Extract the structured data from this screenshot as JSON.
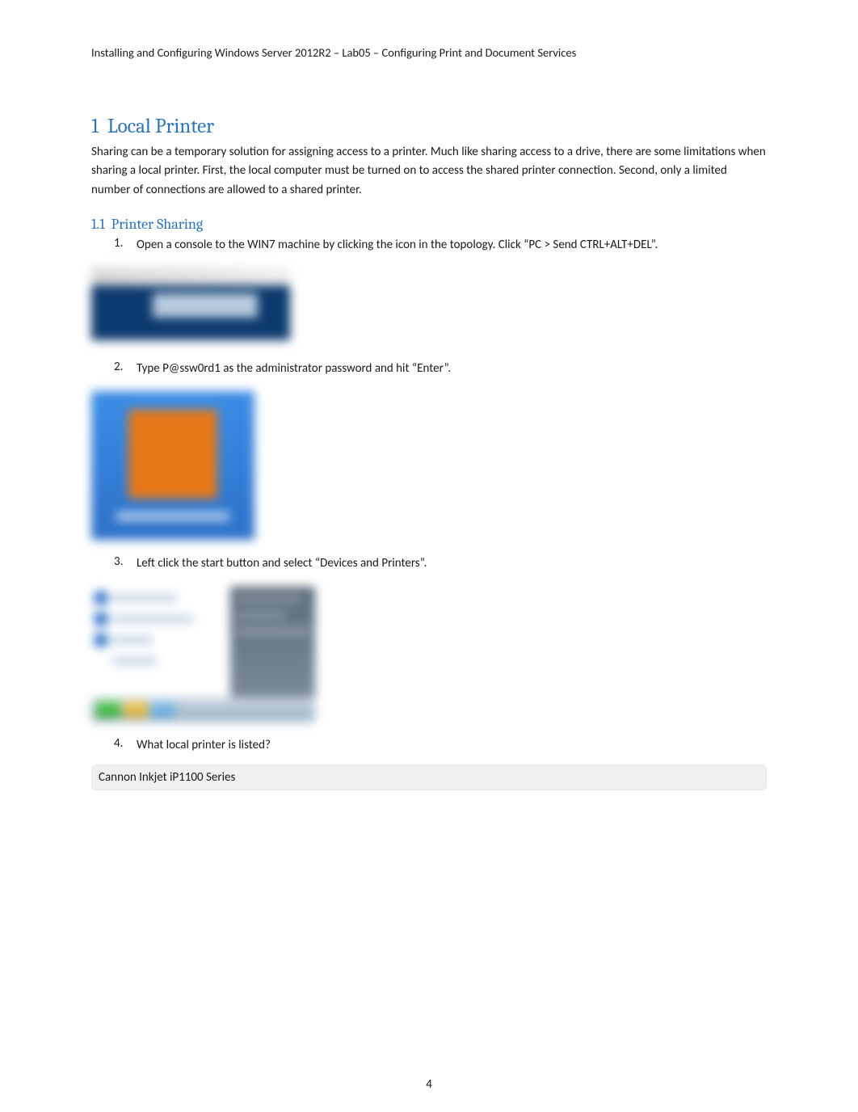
{
  "header": {
    "title": "Installing and Configuring Windows Server 2012R2 – Lab05 – Configuring Print and Document Services"
  },
  "section": {
    "number": "1",
    "title": "Local Printer",
    "intro": "Sharing can be a temporary solution for assigning access to a printer. Much like sharing access to a drive, there are some limitations when sharing a local printer. First, the local computer must be turned on to access the shared printer connection. Second, only a limited number of connections are allowed to a shared printer."
  },
  "subsection": {
    "number": "1.1",
    "title": "Printer Sharing"
  },
  "steps": [
    {
      "num": "1.",
      "text": "Open a console to the WIN7 machine by clicking the icon in the topology. Click “PC > Send CTRL+ALT+DEL”."
    },
    {
      "num": "2.",
      "text": "Type P@ssw0rd1 as the administrator password and hit “Enter”."
    },
    {
      "num": "3.",
      "text": "Left click the start button and select “Devices and Printers”."
    },
    {
      "num": "4.",
      "text": "What local printer is listed?"
    }
  ],
  "answer": "Cannon Inkjet iP1100 Series",
  "page_number": "4"
}
